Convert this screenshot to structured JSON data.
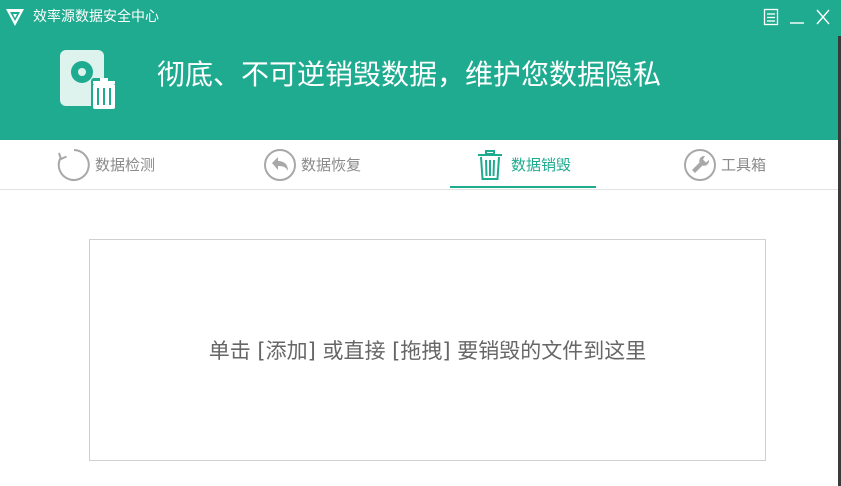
{
  "app": {
    "title": "效率源数据安全中心"
  },
  "window_controls": {
    "menu_icon": "menu-icon",
    "minimize_icon": "minimize-icon",
    "close_icon": "close-icon"
  },
  "banner": {
    "icon": "hard-drive-trash-icon",
    "headline": "彻底、不可逆销毁数据，维护您数据隐私"
  },
  "tabs": [
    {
      "label": "数据检测",
      "icon": "refresh-circle-icon",
      "active": false
    },
    {
      "label": "数据恢复",
      "icon": "undo-circle-icon",
      "active": false
    },
    {
      "label": "数据销毁",
      "icon": "trash-icon",
      "active": true
    },
    {
      "label": "工具箱",
      "icon": "wrench-icon",
      "active": false
    }
  ],
  "dropzone": {
    "hint": "单击 [添加] 或直接 [拖拽] 要销毁的文件到这里"
  },
  "colors": {
    "brand": "#1fab90",
    "text_muted": "#8a8a8a",
    "hint": "#666666",
    "border": "#d0d0d0"
  }
}
